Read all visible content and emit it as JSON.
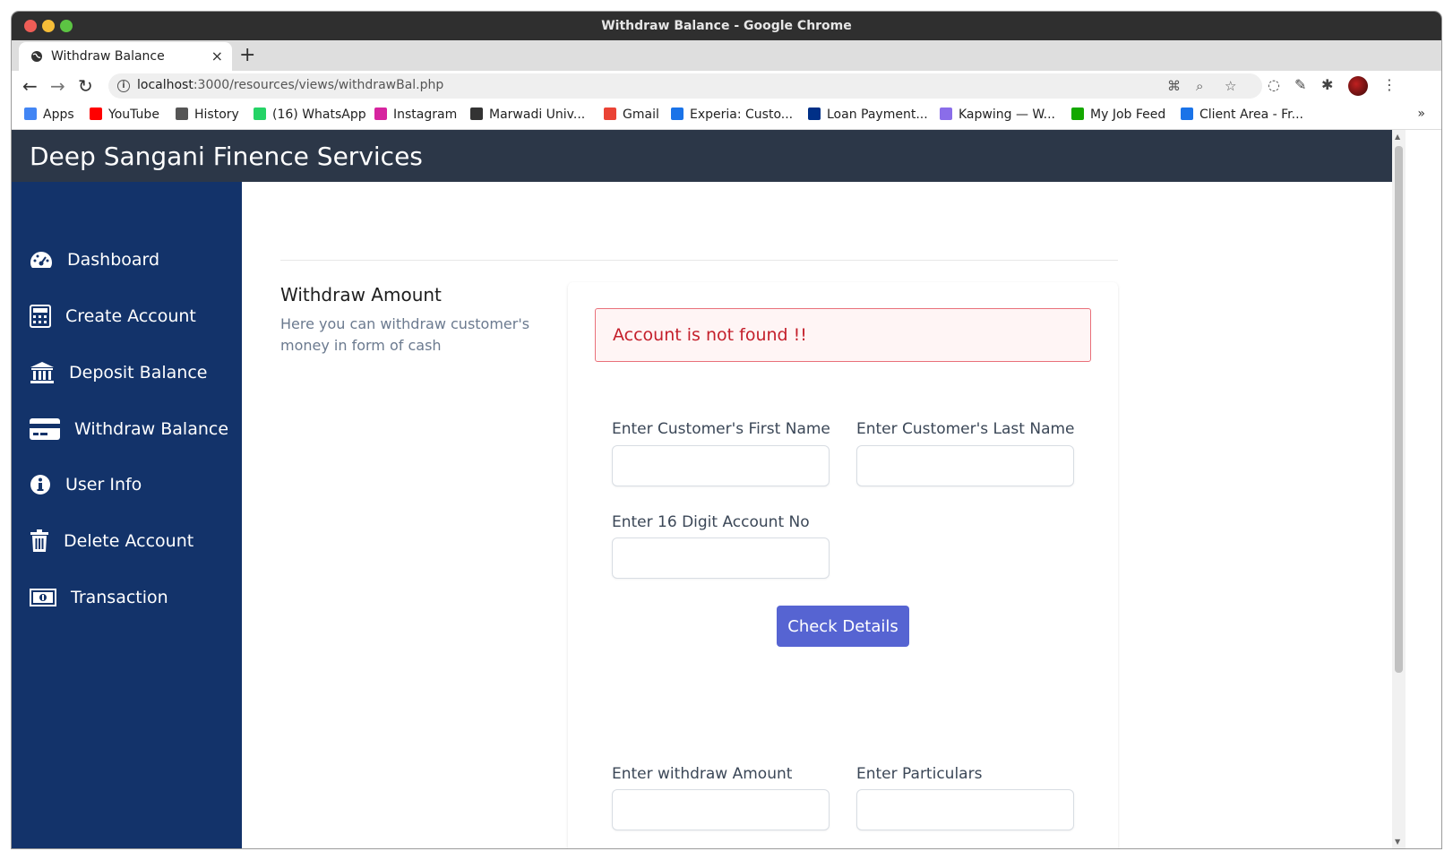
{
  "browser": {
    "window_title": "Withdraw Balance - Google Chrome",
    "tab_title": "Withdraw Balance",
    "new_tab_label": "+",
    "tab_close_label": "×",
    "url_host": "localhost",
    "url_rest": ":3000/resources/views/withdrawBal.php",
    "bookmarks": [
      {
        "label": "Apps",
        "color": "#4285f4"
      },
      {
        "label": "YouTube",
        "color": "#ff0000"
      },
      {
        "label": "History",
        "color": "#555555"
      },
      {
        "label": "(16) WhatsApp",
        "color": "#25d366"
      },
      {
        "label": "Instagram",
        "color": "#d6249f"
      },
      {
        "label": "Marwadi Univ...",
        "color": "#333333"
      },
      {
        "label": "Gmail",
        "color": "#ea4335"
      },
      {
        "label": "Experia: Custo...",
        "color": "#1a73e8"
      },
      {
        "label": "Loan Payment...",
        "color": "#003087"
      },
      {
        "label": "Kapwing — W...",
        "color": "#8a6de9"
      },
      {
        "label": "My Job Feed",
        "color": "#14a800"
      },
      {
        "label": "Client Area - Fr...",
        "color": "#1a73e8"
      }
    ],
    "bookmarks_more": "»"
  },
  "app": {
    "brand": "Deep Sangani Finence Services",
    "sidebar": [
      {
        "label": "Dashboard",
        "icon": "dashboard-icon"
      },
      {
        "label": "Create Account",
        "icon": "calculator-icon"
      },
      {
        "label": "Deposit Balance",
        "icon": "bank-icon"
      },
      {
        "label": "Withdraw Balance",
        "icon": "credit-card-icon"
      },
      {
        "label": "User Info",
        "icon": "info-icon"
      },
      {
        "label": "Delete Account",
        "icon": "trash-icon"
      },
      {
        "label": "Transaction",
        "icon": "money-icon"
      }
    ],
    "section": {
      "title": "Withdraw Amount",
      "description": "Here you can withdraw customer's money in form of cash"
    },
    "alert": "Account is not found !!",
    "form": {
      "first_name_label": "Enter Customer's First Name",
      "last_name_label": "Enter Customer's Last Name",
      "account_no_label": "Enter 16 Digit Account No",
      "check_button": "Check Details",
      "amount_label": "Enter withdraw Amount",
      "particulars_label": "Enter Particulars"
    },
    "colors": {
      "header": "#2c3748",
      "sidebar": "#13336a",
      "button": "#5664d2",
      "alert_text": "#c4202c"
    }
  }
}
